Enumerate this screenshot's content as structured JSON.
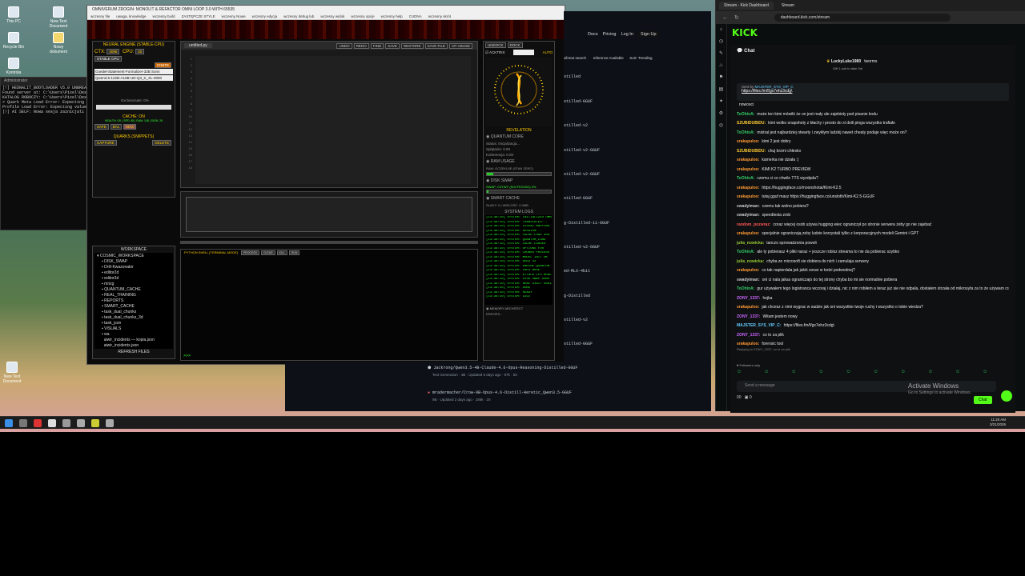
{
  "desktop": {
    "icons": [
      {
        "label": "This PC"
      },
      {
        "label": "New Text Document"
      },
      {
        "label": "Recycle Bin"
      },
      {
        "label": "Nowy dokument"
      },
      {
        "label": "Kontrola"
      },
      {
        "label": "New Text Document"
      }
    ]
  },
  "bg_terminal": {
    "title": "Administrator",
    "lines": [
      "[!] HEDNALIT_BOOTLOADER v5.0 UNBREAK",
      "Found server at: C:\\Users\\Pixel\\Des",
      "KATALOG ROBOCZY: C:\\Users\\Pixel\\Des",
      "> Quark Meta Load Error: Expecting v",
      "Profile Load Error: Expecting value",
      "[!] AI SELF: Nowa sesja zainicjali"
    ]
  },
  "app": {
    "title": "OMNIVERUM ZROGIN: MONOLIT & REFACTOR OMNI LOOP 3.0 WITH 65535",
    "menu": [
      "wczesny file",
      "uwaga, knowledge",
      "wczesny build",
      "ZASTĘPCZE STYLE",
      "wczesny Nowe",
      "wczesny edycja",
      "wczesny debug lub",
      "wczesny widok",
      "wczesny opcje",
      "wczesny help",
      "CUDNA",
      "wczesny skrót"
    ],
    "neural_engine": {
      "title": "NEURAL ENGINE (STABLE-CPU)",
      "ctx_label": "CTX:",
      "ctx_value": "4096",
      "cpu_label": "CPU:",
      "cpu_value": "16",
      "stable_mode": "STABLE CPU",
      "ignite": "IGNITE",
      "model_line1": "Goedel-Statement-Formalizer-32B Sonn",
      "model_line2": "Qwen3.5-122B-A10B-UD-Q3_K_XL-0000",
      "exclusion": "Exclusionate: 0%",
      "cache_on": "CACHE: ON",
      "cache_detail": "HEALTH: OK | SPD: 85 | RAM: 148 | SIGN: 26",
      "safe": "SAFE",
      "bal": "BAL",
      "max": "MAX",
      "quarks_title": "QUARKS (SNIPPETS)",
      "capture": "CAPTURE",
      "delete": "DELETE"
    },
    "workspace": {
      "title": "WORKSPACE",
      "items": [
        "COSMIC_WORKSPACE",
        "DISK_SWAP",
        "Drill-Kwazonator",
        "editor2d",
        "editor3d",
        "mrizg",
        "QUANTUM_CACHE",
        "REAL_TRAINING",
        "REPORTS",
        "SMART_CACHE",
        "task_dual_chunks",
        "task_dual_chunks_3d",
        "task_json",
        "VISUALS",
        "wa",
        "aiwir_incidents — kopia.json",
        "aiwir_incidents.json"
      ],
      "refresh": "REFRESH FILES"
    },
    "editor": {
      "tab": "untitled.py",
      "toolbar": [
        "UNDO",
        "REDO",
        "FIND",
        "SAVE",
        "RESTORE",
        "SAVE FILE",
        "CP-ABUSE"
      ],
      "line_numbers": [
        "1",
        "2",
        "3",
        "4",
        "5",
        "6",
        "7",
        "8",
        "9",
        "10",
        "11",
        "12",
        "13",
        "14",
        "15",
        "16",
        "17",
        "18"
      ]
    },
    "console": {
      "title": "PYTHON SHELL [TERMINAL MODE]",
      "buttons": [
        "PROCESS",
        "CLEAR",
        "KILL",
        "RUN"
      ],
      "prompt": ">>>"
    },
    "right_panel": {
      "tabs": [
        "UNDOCK",
        "DOCK"
      ],
      "actrix": "ACKTRIX",
      "auto": "AUTO",
      "revelation": "REVELATION",
      "quantum_core": "QUANTUM CORE",
      "status_lines": [
        "Status: Inicjalizacja...",
        "Splątanie: 0.00",
        "Koherencja: 0.00"
      ],
      "ram_title": "RAM USAGE",
      "ram_status": "RAM: OCZEKUJE (STAN ZERO)",
      "ram_progress": 0.1,
      "swap_title": "DISK SWAP",
      "swap_status": "SWAP: CZYWY (SOI FEGOIO) 3%",
      "swap_progress": 0.03,
      "smart_cache": "SMART CACHE",
      "smart_cache_status": "SŁADY: 0 | WIELOŚĆ: 0.0MB",
      "system_logs": "SYSTEM LOGS",
      "logs": [
        "[13:36:10] SYSTEM: INITIALIZED OMNI",
        "[13:36:10] SYSTEM: TRANSLATED...",
        "[13:36:10] SYSTEM: VISUAL MAPPING",
        "[13:36:10] SYSTEM: SESSION...",
        "[13:36:10] SYSTEM: CACHE LOAD 30G",
        "[13:36:10] SYSTEM: QUANTUM_LOAD",
        "[13:36:10] SYSTEM: CACHE LOADED",
        "[13:36:10] SYSTEM: OPTIONS FOR",
        "[13:36:10] SYSTEM: CHUNKS PROCESS",
        "[13:36:10] SYSTEM: MODEL INIT OK",
        "[13:36:10] SYSTEM: SEED 42",
        "[13:36:10] SYSTEM: ENGINE QUANTUM",
        "[13:36:10] SYSTEM: INFO NODE",
        "[13:36:10] SYSTEM: ATTACK CPU MODE",
        "[13:36:10] SYSTEM: DISK SWAP DONE",
        "[13:36:10] SYSTEM: REAL DIGIT ENGINE",
        "[13:36:10] SYSTEM: DONE",
        "[13:36:10] SYSTEM: READY",
        "[13:36:10] SYSTEM: IDLE"
      ],
      "memory_title": "MEMORY ARCHITECT",
      "memory_status": "ERRORS..."
    }
  },
  "mid_browser": {
    "nav": [
      "Docs",
      "Pricing",
      "Log In",
      "Sign Up"
    ],
    "filters": [
      "ull-text search",
      "Inference Available",
      "Sort: Trending"
    ],
    "rows": [
      "stilled",
      "stilled-GGUF",
      "stilled-v2",
      "stilled-v2-GGUF",
      "stilled-v2-GGUF",
      "stilled-GGUF",
      "g-Distilled-11-GGUF",
      "stilled-v2-GGUF",
      "ed-MLX-4bit",
      "g-Distilled",
      "stilled-v2",
      "stilled-GGUF"
    ],
    "bottom1": "Jackrong/Qwen3.5-4B-Claude-4.6-Opus-Reasoning-Distilled-GGUF",
    "bottom1_meta": "Text Generation · 4B · Updated 6 days ago · 97k · 53",
    "bottom2": "mradermacher/Crow-9B-Opus-4.6-Distill-Heretic_Qwen3.5-GGUF",
    "bottom2_meta": "9B · Updated 2 days ago · 186k · 20"
  },
  "kick": {
    "tabs": [
      "Stream - Kick Dashboard",
      "Stream"
    ],
    "url": "dashboard.kick.com/stream",
    "logo": "KICK",
    "chat_title": "Chat",
    "top_gifter": "LuckyLuke1980",
    "top_gifter2": "tworms",
    "gift_note": "Gift 1 sub to take 3rd",
    "pinned_by": "Sent by",
    "pinned_user": "MAJSTER_SYS_VIP_C",
    "pinned_link": "https://files.fm/f/gx7ehz3cdg\\",
    "messages": [
      {
        "user": "",
        "text": "nowosci",
        "color": "#bbb"
      },
      {
        "user": "ToOhinA:",
        "text": "może ten kimi mówiłś że on jest mały ale zajebisty pod pisanie kodu",
        "color": "#3c6"
      },
      {
        "user": "SZUBIDUBIDU:",
        "text": "kimi wolko snapshoty z błachy i prosto do sl doili pinga wszystko trafiało",
        "color": "#fc3"
      },
      {
        "user": "ToOhinA:",
        "text": "mistral jest najbardziej otwarty i zwykłym ludzkij nawet cheaty podaje więc może on?",
        "color": "#3c6"
      },
      {
        "user": "srakapuloo:",
        "text": "kimi 2 jest dobry",
        "color": "#f93"
      },
      {
        "user": "SZUBIDUBIDU:",
        "text": "chuj brzmi chłesko",
        "color": "#fc3"
      },
      {
        "user": "srakapuloo:",
        "text": "kamerka nie działa :(",
        "color": "#f93"
      },
      {
        "user": "srakapuloo:",
        "text": "KIMI K2 TURBO PREVIEW",
        "color": "#f93"
      },
      {
        "user": "ToOhinA:",
        "text": "czemu ci co chwile TTS wyzdpda?",
        "color": "#3c6"
      },
      {
        "user": "srakapuloo:",
        "text": "https://huggingface.co/moonshotai/Kimi-K2.5",
        "color": "#f93"
      },
      {
        "user": "srakapuloo:",
        "text": "tutaj gguf masz https://huggingface.co/unsloth/Kimi-K2.5-GGUF",
        "color": "#f93"
      },
      {
        "user": "swadyiman:",
        "text": "czemu tak wolno pobiera?",
        "color": "#ccc"
      },
      {
        "user": "swadyiman:",
        "text": "speedtesta zrob",
        "color": "#ccc"
      },
      {
        "user": "random_pozwraz:",
        "text": "coraz więcej osob używa hugging wiec ograniczył po stronie serwera żeby go nie zajebać",
        "color": "#f55"
      },
      {
        "user": "srakapuloo:",
        "text": "specjalnie ograniczają zeby ludzie korzystali tylko z korporacyjnych modeli Gemini i GPT",
        "color": "#f93"
      },
      {
        "user": "julia_nowicka:",
        "text": "tanczo sprowadzonia powoli",
        "color": "#9c3"
      },
      {
        "user": "ToOhinA:",
        "text": "ale ty pobierasz 4 pliki naraz + jeszcze robisz streama to nie da pobierac szybko",
        "color": "#3c6"
      },
      {
        "user": "julia_nowicka:",
        "text": "chyba ze microsoft sie dobiera do nich i zamulaja serwery",
        "color": "#9c3"
      },
      {
        "user": "srakapuloo:",
        "text": "co tak napierdala jak jakiś zonar w todzi podwodnej?",
        "color": "#f93"
      },
      {
        "user": "swadyiman:",
        "text": "oni ci nala jakas ograniczajo do tej strony chyba bo mi sie normalnie pobiera",
        "color": "#ccc"
      },
      {
        "user": "ToOhinA:",
        "text": "gur używałem tego logistranca wczoraj i działaj, nic z nim robiłem a teraz już sie nie odpala, dostałem strzała od mikrosyfa za to że używam cracga co pokazuje ich kłamstwa",
        "color": "#3c6"
      },
      {
        "user": "ZONY_1337:",
        "text": "hejka",
        "color": "#c6f"
      },
      {
        "user": "srakapuloo:",
        "text": "jak chcesz z nimi wygrac w sadzie jak oni wszystkie twoje ruchy i wszystko o tobie wiedza?",
        "color": "#f93"
      },
      {
        "user": "ZONY_1337:",
        "text": "Witam jestem nowy",
        "color": "#c6f"
      },
      {
        "user": "MAJSTER_SYS_VIP_C:",
        "text": "https://files.fm/f/gx7ehz3cdg\\",
        "color": "#6cf"
      },
      {
        "user": "ZONY_1337:",
        "text": "co to za plik",
        "color": "#c6f"
      },
      {
        "user": "srakapuloo:",
        "text": "forensic tool",
        "color": "#f93"
      }
    ],
    "reply_note": "Replying to ZONY_1337: co to za plik",
    "followers": "Followers only",
    "input_placeholder": "Send a message",
    "send_label": "Chat",
    "counter1": "00",
    "counter2": "0",
    "activate_title": "Activate Windows",
    "activate_sub": "Go to Settings to activate Windows."
  },
  "taskbar": {
    "time": "11:20 AM",
    "date": "3/21/2026"
  }
}
